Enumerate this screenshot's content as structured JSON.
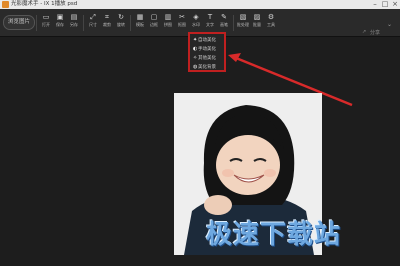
{
  "window": {
    "title": "光影魔术手 - IX 1播放 psd"
  },
  "toolbar": {
    "open_label": "浏览图片",
    "tools": [
      {
        "label": "打开",
        "icon": "folder-icon"
      },
      {
        "label": "保存",
        "icon": "save-icon"
      },
      {
        "label": "另存",
        "icon": "save-as-icon"
      },
      {
        "label": "尺寸",
        "icon": "resize-icon"
      },
      {
        "label": "裁剪",
        "icon": "crop-icon"
      },
      {
        "label": "旋转",
        "icon": "rotate-icon"
      },
      {
        "label": "模板",
        "icon": "template-icon"
      },
      {
        "label": "边框",
        "icon": "frame-icon"
      },
      {
        "label": "拼图",
        "icon": "puzzle-icon"
      },
      {
        "label": "抠图",
        "icon": "cutout-icon"
      },
      {
        "label": "水印",
        "icon": "watermark-icon"
      },
      {
        "label": "文字",
        "icon": "text-icon"
      },
      {
        "label": "画笔",
        "icon": "brush-icon"
      },
      {
        "label": "批处理",
        "icon": "batch-icon"
      },
      {
        "label": "批量",
        "icon": "batch-icon"
      },
      {
        "label": "工具",
        "icon": "tool-icon"
      }
    ],
    "right_label": "分享"
  },
  "dropdown": {
    "items": [
      {
        "label": "自动美化",
        "icon": "sparkle-icon"
      },
      {
        "label": "手动美化",
        "icon": "magic-icon"
      },
      {
        "label": "其他美化",
        "icon": "wand-icon"
      },
      {
        "label": "美化背景",
        "icon": "palette-icon"
      }
    ]
  },
  "watermark": {
    "text": "极速下载站"
  }
}
